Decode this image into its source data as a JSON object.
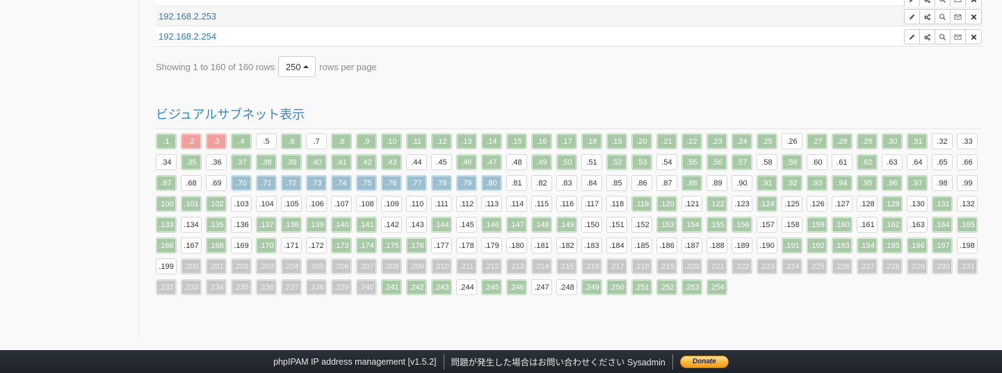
{
  "ip_table": {
    "rows": [
      {
        "ip": "192.168.2.253"
      },
      {
        "ip": "192.168.2.254"
      }
    ],
    "row_actions": [
      {
        "name": "edit",
        "icon": "pencil-icon"
      },
      {
        "name": "manage",
        "icon": "cogs-icon"
      },
      {
        "name": "search",
        "icon": "search-icon"
      },
      {
        "name": "mail",
        "icon": "envelope-icon"
      },
      {
        "name": "delete",
        "icon": "close-icon"
      }
    ]
  },
  "pager": {
    "showing_text": "Showing 1 to 160 of 160 rows",
    "page_size": "250",
    "suffix_text": "rows per page"
  },
  "visual_subnet": {
    "title": "ビジュアルサブネット表示",
    "legend_colors": {
      "used": "#a8c9a6",
      "free": "#ffffff",
      "offline": "#f0a09c",
      "reserved": "#9cbfcf",
      "dhcp": "#c6c6c6"
    },
    "used": [
      1,
      4,
      6,
      8,
      9,
      10,
      11,
      12,
      13,
      14,
      15,
      16,
      17,
      18,
      19,
      20,
      21,
      22,
      23,
      24,
      25,
      27,
      28,
      29,
      30,
      31,
      35,
      37,
      38,
      39,
      40,
      41,
      42,
      43,
      46,
      47,
      49,
      50,
      52,
      53,
      55,
      56,
      57,
      59,
      62,
      67,
      88,
      91,
      92,
      93,
      94,
      95,
      96,
      97,
      100,
      101,
      102,
      119,
      120,
      122,
      124,
      129,
      131,
      133,
      135,
      137,
      138,
      139,
      140,
      141,
      144,
      146,
      147,
      148,
      149,
      153,
      154,
      155,
      156,
      159,
      160,
      162,
      164,
      165,
      166,
      168,
      170,
      173,
      174,
      175,
      176,
      191,
      192,
      193,
      194,
      195,
      196,
      197,
      241,
      242,
      243,
      245,
      246,
      249,
      250,
      251,
      252,
      253,
      254
    ],
    "offline": [
      2,
      3
    ],
    "reserved": [
      70,
      71,
      72,
      73,
      74,
      75,
      76,
      77,
      78,
      79,
      80
    ],
    "dhcp": [
      200,
      201,
      202,
      203,
      204,
      205,
      206,
      207,
      208,
      209,
      210,
      211,
      212,
      213,
      214,
      215,
      216,
      217,
      218,
      219,
      220,
      221,
      222,
      223,
      224,
      225,
      226,
      227,
      228,
      229,
      230,
      231,
      232,
      233,
      234,
      235,
      236,
      237,
      238,
      239,
      240
    ],
    "first": 1,
    "last": 254
  },
  "footer": {
    "app_text": "phpIPAM IP address management [v1.5.2]",
    "contact_text": "問題が発生した場合はお問い合わせください Sysadmin",
    "donate_label": "Donate"
  }
}
